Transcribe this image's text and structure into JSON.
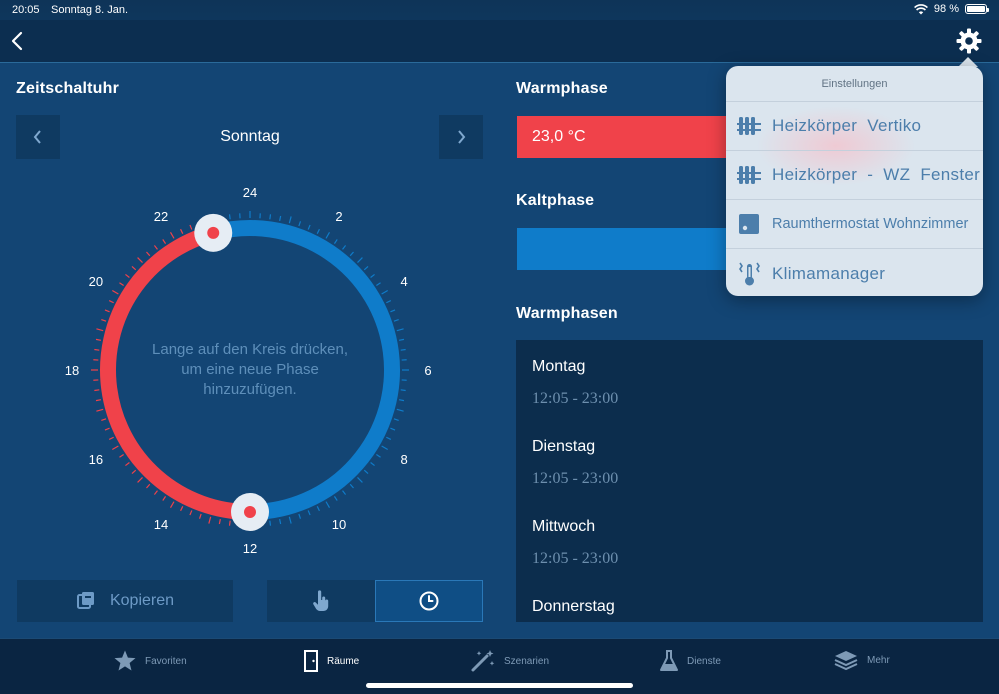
{
  "status": {
    "time": "20:05",
    "date": "Sonntag 8. Jan.",
    "battery": "98 %"
  },
  "timer": {
    "title": "Zeitschaltuhr",
    "day": "Sonntag",
    "hint_line1": "Lange auf den Kreis drücken,",
    "hint_line2": "um eine neue Phase",
    "hint_line3": "hinzuzufügen.",
    "hours": [
      "24",
      "2",
      "4",
      "6",
      "8",
      "10",
      "12",
      "14",
      "16",
      "18",
      "20",
      "22"
    ],
    "warm_start_hour": 12,
    "warm_end_hour": 23,
    "colors": {
      "warm": "#f0424a",
      "cold": "#0f7cca"
    }
  },
  "warmphase": {
    "title": "Warmphase",
    "value": "23,0 °C"
  },
  "kaltphase": {
    "title": "Kaltphase"
  },
  "warmphasen": {
    "title": "Warmphasen",
    "items": [
      {
        "day": "Montag",
        "time": "12:05 - 23:00"
      },
      {
        "day": "Dienstag",
        "time": "12:05 - 23:00"
      },
      {
        "day": "Mittwoch",
        "time": "12:05 - 23:00"
      },
      {
        "day": "Donnerstag",
        "time": ""
      }
    ]
  },
  "buttons": {
    "copy": "Kopieren"
  },
  "popover": {
    "title": "Einstellungen",
    "items": [
      {
        "label": "Heizkörper  Vertiko",
        "icon": "radiator-icon"
      },
      {
        "label": "Heizkörper  -  WZ  Fenster",
        "icon": "radiator-icon"
      },
      {
        "label": "Raumthermostat Wohnzimmer",
        "icon": "thermostat-icon"
      },
      {
        "label": "Klimamanager",
        "icon": "climate-manager-icon"
      }
    ]
  },
  "tabs": [
    {
      "label": "Favoriten",
      "icon": "star-icon"
    },
    {
      "label": "Räume",
      "icon": "door-icon",
      "active": true
    },
    {
      "label": "Szenarien",
      "icon": "magic-wand-icon"
    },
    {
      "label": "Dienste",
      "icon": "flask-icon"
    },
    {
      "label": "Mehr",
      "icon": "layers-icon"
    }
  ]
}
